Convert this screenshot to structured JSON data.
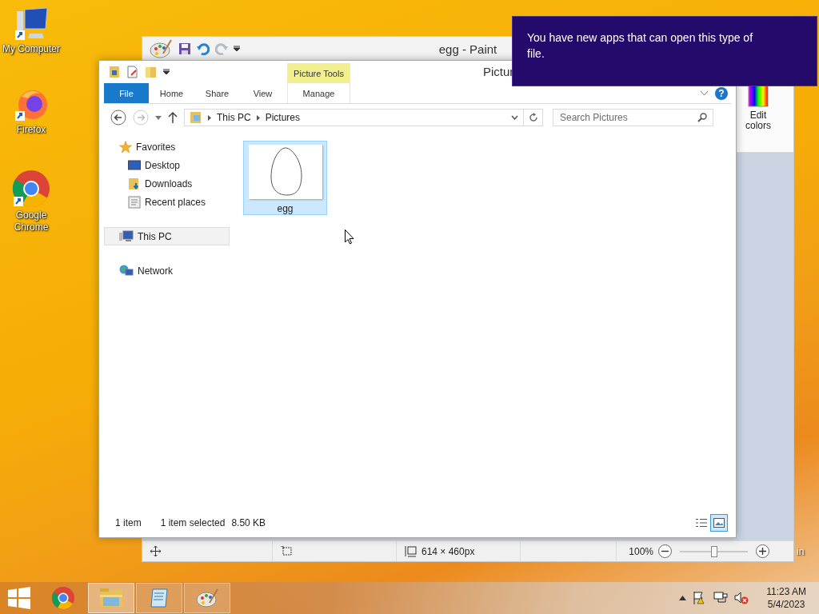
{
  "desktop_icons": [
    {
      "label": "My Computer",
      "kind": "computer"
    },
    {
      "label": "Firefox",
      "kind": "firefox"
    },
    {
      "label": "Google Chrome",
      "kind": "chrome"
    }
  ],
  "desktop_edge_text": "in",
  "paint": {
    "title": "egg - Paint",
    "ribbon_button": "Edit colors",
    "status": {
      "size": "614 × 460px",
      "zoom": "100%",
      "zoom_slider": {
        "level": 0.5
      }
    }
  },
  "explorer": {
    "title": "Pictur",
    "context_group": "Picture Tools",
    "tabs": [
      {
        "label": "File",
        "kind": "file",
        "selected": false
      },
      {
        "label": "Home",
        "kind": "plain",
        "selected": false
      },
      {
        "label": "Share",
        "kind": "plain",
        "selected": false
      },
      {
        "label": "View",
        "kind": "plain",
        "selected": false
      },
      {
        "label": "Manage",
        "kind": "context",
        "selected": false
      }
    ],
    "help_glyph": "?",
    "breadcrumb": [
      "This PC",
      "Pictures"
    ],
    "search": {
      "placeholder": "Search Pictures"
    },
    "nav": [
      {
        "label": "Favorites",
        "kind": "favorites",
        "selected": false,
        "children": [
          {
            "label": "Desktop",
            "kind": "desktop",
            "selected": false
          },
          {
            "label": "Downloads",
            "kind": "downloads",
            "selected": false
          },
          {
            "label": "Recent places",
            "kind": "recent",
            "selected": false
          }
        ]
      },
      {
        "label": "This PC",
        "kind": "pc",
        "selected": true
      },
      {
        "label": "Network",
        "kind": "network",
        "selected": false
      }
    ],
    "files": [
      {
        "name": "egg",
        "selected": true
      }
    ],
    "status": {
      "count": "1 item",
      "selection": "1 item selected",
      "size": "8.50 KB"
    },
    "views": [
      {
        "kind": "details",
        "selected": false
      },
      {
        "kind": "large-icons",
        "selected": true
      }
    ]
  },
  "notification": {
    "text": "You have new apps that can open this type of file."
  },
  "taskbar": {
    "apps": [
      {
        "kind": "chrome",
        "running": false,
        "active": false
      },
      {
        "kind": "explorer",
        "running": true,
        "active": true
      },
      {
        "kind": "notepad",
        "running": true,
        "active": false
      },
      {
        "kind": "paint",
        "running": true,
        "active": false
      }
    ],
    "time": "11:23 AM",
    "date": "5/4/2023"
  }
}
